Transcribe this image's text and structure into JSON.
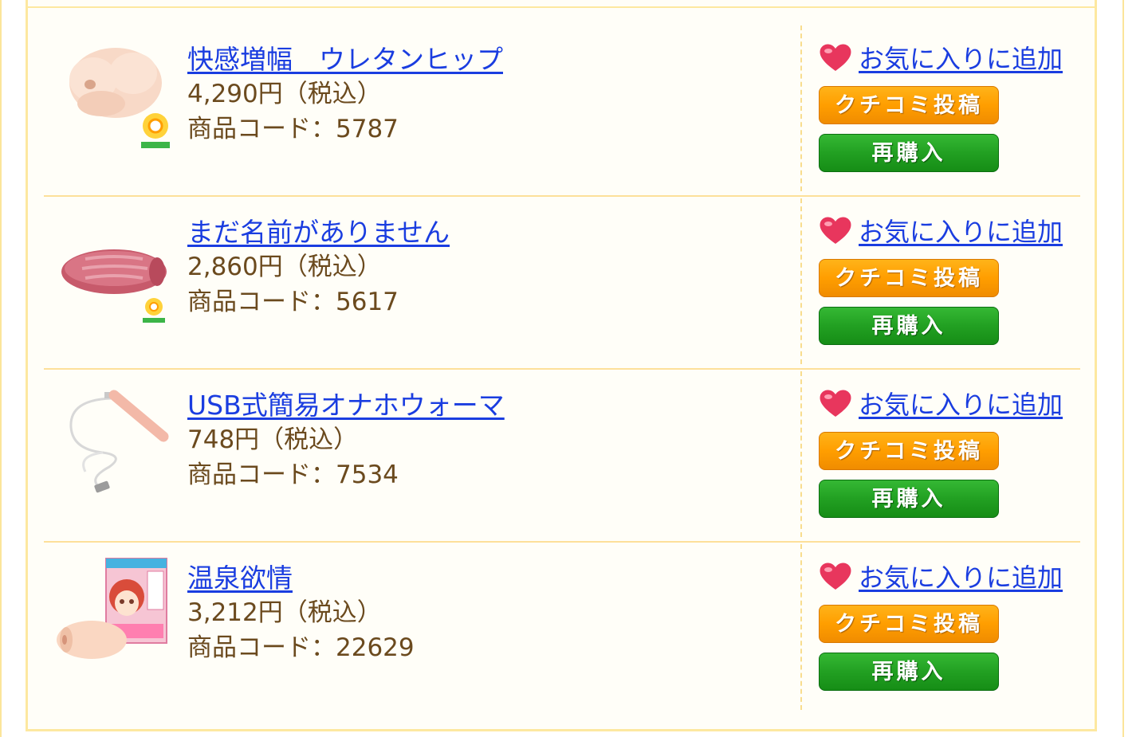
{
  "items": [
    {
      "name": "快感増幅　ウレタンヒップ",
      "price": "4,290円（税込）",
      "code": "商品コード：5787",
      "fav_label": "お気に入りに追加",
      "review_label": "クチコミ投稿",
      "rebuy_label": "再購入",
      "thumb_icon": "hip-product-image"
    },
    {
      "name": "まだ名前がありません",
      "price": "2,860円（税込）",
      "code": "商品コード：5617",
      "fav_label": "お気に入りに追加",
      "review_label": "クチコミ投稿",
      "rebuy_label": "再購入",
      "thumb_icon": "sleeve-product-image"
    },
    {
      "name": "USB式簡易オナホウォーマ",
      "price": "748円（税込）",
      "code": "商品コード：7534",
      "fav_label": "お気に入りに追加",
      "review_label": "クチコミ投稿",
      "rebuy_label": "再購入",
      "thumb_icon": "usb-warmer-product-image"
    },
    {
      "name": "温泉欲情",
      "price": "3,212円（税込）",
      "code": "商品コード：22629",
      "fav_label": "お気に入りに追加",
      "review_label": "クチコミ投稿",
      "rebuy_label": "再購入",
      "thumb_icon": "boxed-product-image"
    }
  ],
  "colors": {
    "link": "#1a3de0",
    "text": "#6b4a1e",
    "review_button": "#ff9e00",
    "rebuy_button": "#22a022",
    "border": "#fde8a0",
    "heart": "#e8365d"
  }
}
